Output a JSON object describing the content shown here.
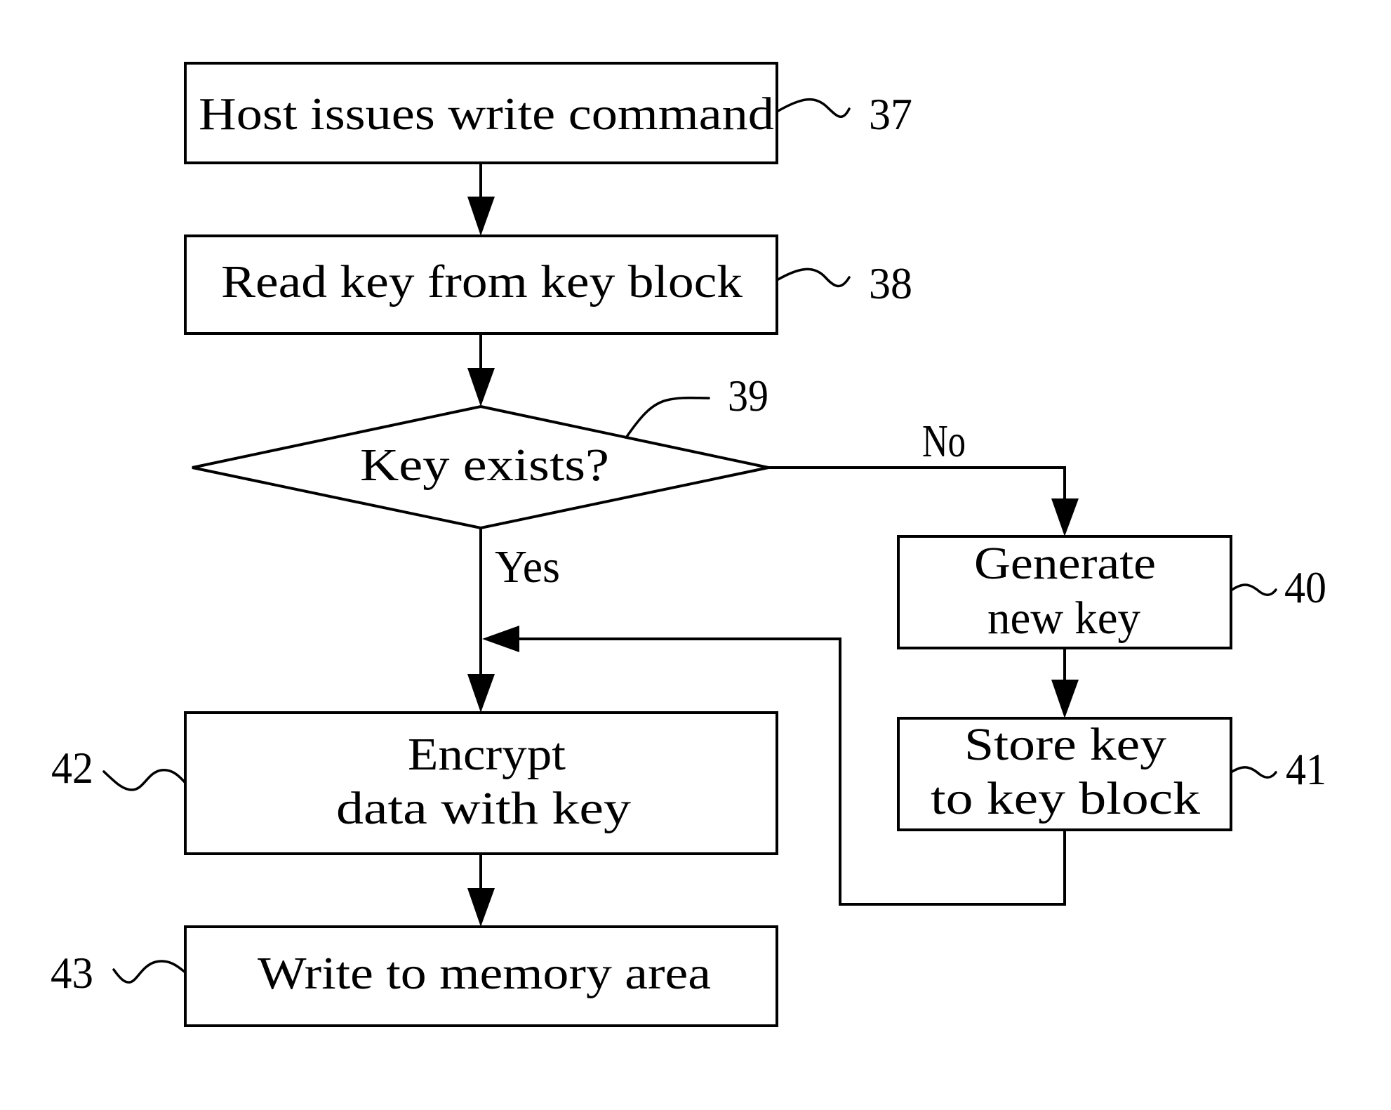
{
  "diagram": {
    "type": "flowchart",
    "colors": {
      "stroke": "#000000",
      "background": "#ffffff"
    },
    "steps": [
      {
        "ref": "37",
        "kind": "process",
        "lines": [
          "Host issues write command"
        ]
      },
      {
        "ref": "38",
        "kind": "process",
        "lines": [
          "Read key from key block"
        ]
      },
      {
        "ref": "39",
        "kind": "decision",
        "lines": [
          "Key exists?"
        ]
      },
      {
        "ref": "40",
        "kind": "process",
        "lines": [
          "Generate",
          "new key"
        ]
      },
      {
        "ref": "41",
        "kind": "process",
        "lines": [
          "Store key",
          "to key block"
        ]
      },
      {
        "ref": "42",
        "kind": "process",
        "lines": [
          "Encrypt",
          "data with key"
        ]
      },
      {
        "ref": "43",
        "kind": "process",
        "lines": [
          "Write to memory area"
        ]
      }
    ],
    "branch_labels": {
      "yes": "Yes",
      "no": "No"
    },
    "edges": [
      {
        "from": "37",
        "to": "38"
      },
      {
        "from": "38",
        "to": "39"
      },
      {
        "from": "39",
        "to": "42",
        "label": "Yes"
      },
      {
        "from": "39",
        "to": "40",
        "label": "No"
      },
      {
        "from": "40",
        "to": "41"
      },
      {
        "from": "41",
        "to": "42"
      },
      {
        "from": "42",
        "to": "43"
      }
    ]
  }
}
